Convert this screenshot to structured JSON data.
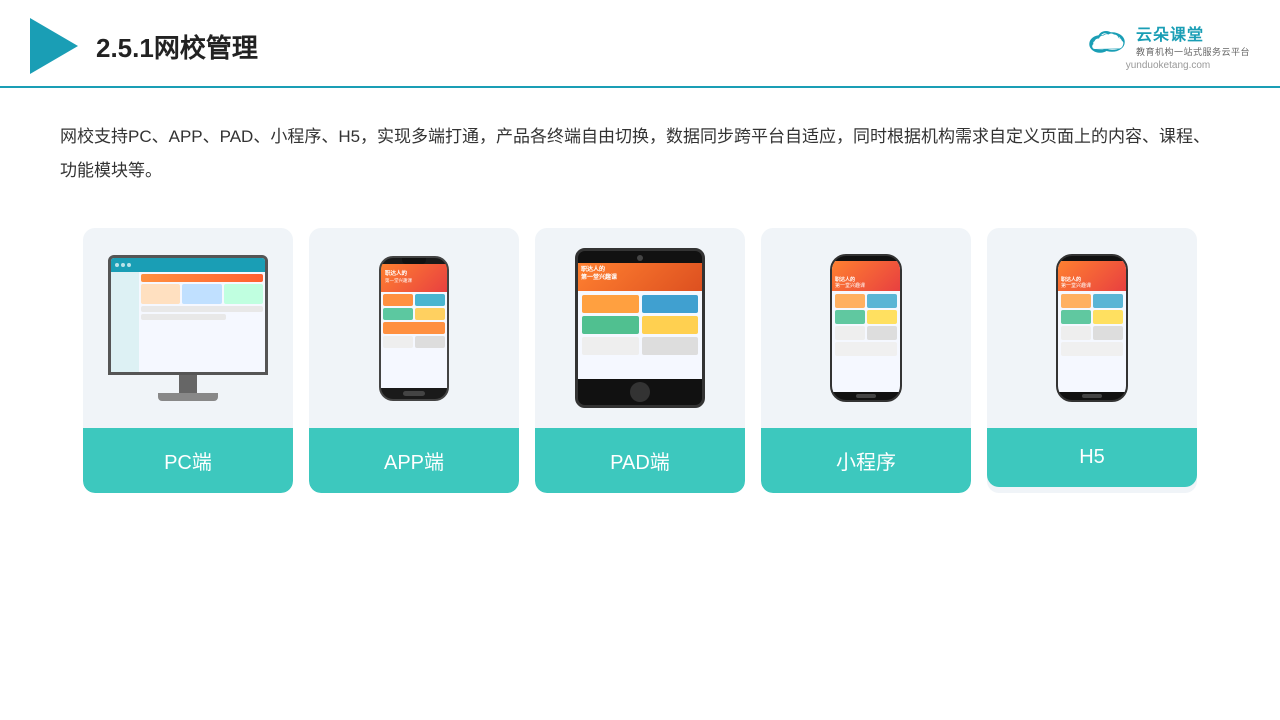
{
  "header": {
    "title": "2.5.1网校管理",
    "brand": {
      "name": "云朵课堂",
      "subtitle": "教育机构一站式服务云平台",
      "url": "yunduoketang.com"
    }
  },
  "description": "网校支持PC、APP、PAD、小程序、H5，实现多端打通，产品各终端自由切换，数据同步跨平台自适应，同时根据机构需求自定义页面上的内容、课程、功能模块等。",
  "cards": [
    {
      "id": "pc",
      "label": "PC端"
    },
    {
      "id": "app",
      "label": "APP端"
    },
    {
      "id": "pad",
      "label": "PAD端"
    },
    {
      "id": "miniprogram",
      "label": "小程序"
    },
    {
      "id": "h5",
      "label": "H5"
    }
  ]
}
